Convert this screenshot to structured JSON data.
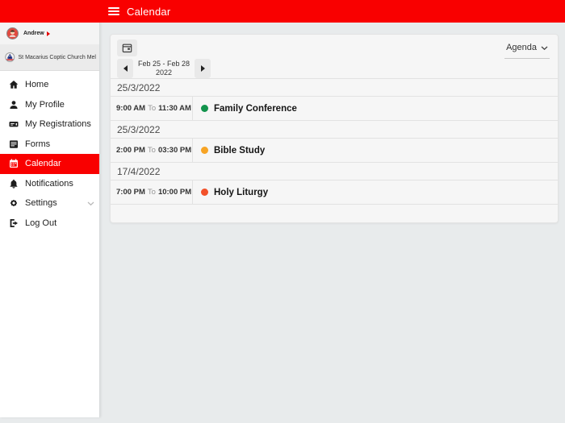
{
  "topbar": {
    "title": "Calendar",
    "color": "#f90000"
  },
  "sidebar": {
    "user": {
      "name": "Andrew"
    },
    "org": {
      "name": "St Macarius Coptic Church Mel"
    },
    "items": [
      {
        "label": "Home",
        "icon": "home-icon",
        "active": false
      },
      {
        "label": "My Profile",
        "icon": "person-icon",
        "active": false
      },
      {
        "label": "My Registrations",
        "icon": "ticket-icon",
        "active": false
      },
      {
        "label": "Forms",
        "icon": "form-icon",
        "active": false
      },
      {
        "label": "Calendar",
        "icon": "calendar-icon",
        "active": true
      },
      {
        "label": "Notifications",
        "icon": "bell-icon",
        "active": false
      },
      {
        "label": "Settings",
        "icon": "gear-icon",
        "active": false,
        "has_chevron": true
      },
      {
        "label": "Log Out",
        "icon": "logout-icon",
        "active": false
      }
    ]
  },
  "calendar": {
    "toolbar": {
      "view_label": "Agenda",
      "range_line1": "Feb 25 - Feb 28",
      "range_line2": "2022"
    },
    "groups": [
      {
        "date": "25/3/2022",
        "events": [
          {
            "start": "9:00 AM",
            "to": "To",
            "end": "11:30 AM",
            "title": "Family Conference",
            "color": "#12934c"
          }
        ]
      },
      {
        "date": "25/3/2022",
        "events": [
          {
            "start": "2:00 PM",
            "to": "To",
            "end": "03:30 PM",
            "title": "Bible Study",
            "color": "#f7a425"
          }
        ]
      },
      {
        "date": "17/4/2022",
        "events": [
          {
            "start": "7:00 PM",
            "to": "To",
            "end": "10:00 PM",
            "title": "Holy Liturgy",
            "color": "#f2512a"
          }
        ]
      }
    ]
  }
}
